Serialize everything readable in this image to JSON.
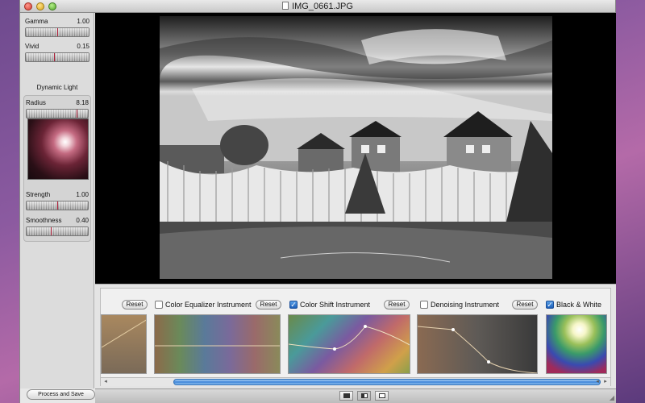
{
  "window": {
    "title": "IMG_0661.JPG"
  },
  "sidebar": {
    "gamma": {
      "label": "Gamma",
      "value": "1.00",
      "level": 0.5
    },
    "vivid": {
      "label": "Vivid",
      "value": "0.15",
      "level": 0.45
    },
    "section_title": "Dynamic Light",
    "radius": {
      "label": "Radius",
      "value": "8.18",
      "level": 0.82
    },
    "strength": {
      "label": "Strength",
      "value": "1.00",
      "level": 0.5
    },
    "smoothness": {
      "label": "Smoothness",
      "value": "0.40",
      "level": 0.4
    }
  },
  "instruments": {
    "reset_label": "Reset",
    "color_equalizer": {
      "label": "Color Equalizer Instrument",
      "checked": false
    },
    "color_shift": {
      "label": "Color Shift Instrument",
      "checked": true
    },
    "denoising": {
      "label": "Denoising Instrument",
      "checked": false
    },
    "black_white": {
      "label": "Black & White",
      "checked": true
    }
  },
  "footer": {
    "process_button": "Process and Save"
  },
  "icons": {
    "close": "close-icon",
    "minimize": "minimize-icon",
    "zoom": "zoom-icon",
    "document": "document-icon",
    "view_single": "view-single-icon",
    "view_split": "view-split-icon",
    "view_original": "view-original-icon"
  },
  "colors": {
    "accent": "#3f86d8",
    "desktop": "#8b5aa0",
    "check_on": "#1c5fb8"
  }
}
